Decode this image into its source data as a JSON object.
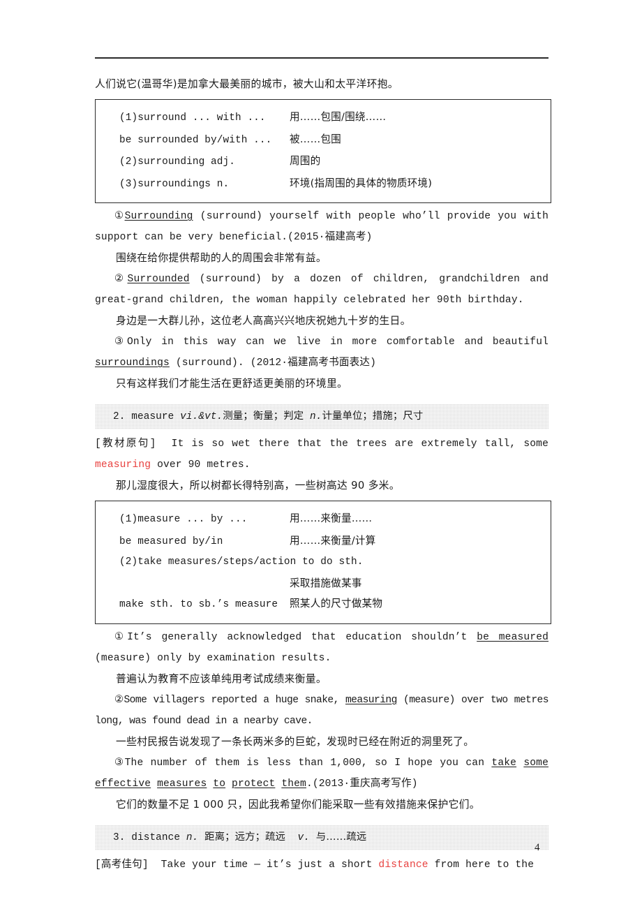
{
  "page": {
    "number": "4",
    "top_rule": true
  },
  "sections": [
    {
      "id": "surround-translation",
      "type": "chinese-paragraph",
      "text": "人们说它(温哥华)是加拿大最美丽的城市，被大山和太平洋环抱。"
    },
    {
      "id": "surround-table",
      "type": "phrase-box",
      "rows": [
        {
          "en": "(1)surround ... with ...",
          "cn": "用……包围/围绕……"
        },
        {
          "en": "be surrounded by/with ...",
          "cn": "被……包围"
        },
        {
          "en": "(2)surrounding adj.",
          "en_italic": "adj.",
          "cn": "周围的"
        },
        {
          "en": "(3)surroundings n.",
          "en_italic": "n.",
          "cn": "环境(指周围的具体的物质环境)"
        }
      ]
    },
    {
      "id": "surround-example-1",
      "type": "example",
      "marker": "①",
      "answer": "Surrounding",
      "en_before": "",
      "en_after": " (surround) yourself with people who’ll provide you with support can be very beneficial.(2015·福建高考)",
      "cn": "围绕在给你提供帮助的人的周围会非常有益。"
    },
    {
      "id": "surround-example-2",
      "type": "example",
      "marker": "②",
      "answer": "Surrounded",
      "en_after": " (surround) by a dozen of children, grandchildren and great-grand children, the woman happily celebrated her 90th birthday.",
      "cn": "身边是一大群儿孙，这位老人高高兴兴地庆祝她九十岁的生日。"
    },
    {
      "id": "surround-example-3",
      "type": "example",
      "marker": "③",
      "en_before": "Only in this way can we live in more comfortable and beautiful ",
      "answer": "surroundings",
      "en_after": " (surround). (2012·福建高考书面表达)",
      "cn": "只有这样我们才能生活在更舒适更美丽的环境里。"
    },
    {
      "id": "measure-heading",
      "type": "gray-heading",
      "number": "2.",
      "word": "measure",
      "pos": "vi.&vt.",
      "def1": "测量；衡量；判定",
      "pos2": "n.",
      "def2": "计量单位；措施；尺寸"
    },
    {
      "id": "measure-textbook",
      "type": "textbook-sentence",
      "tag": "[教材原句]",
      "en_before": "It is so wet there that the trees are extremely tall, some ",
      "highlight": "measuring",
      "en_after": " over 90 metres.",
      "cn": "那儿湿度很大，所以树都长得特别高，一些树高达 90 多米。"
    },
    {
      "id": "measure-table",
      "type": "phrase-box",
      "rows": [
        {
          "en": "(1)measure ... by ...",
          "cn": "用……来衡量……"
        },
        {
          "en": "be measured by/in",
          "cn": "用……来衡量/计算"
        },
        {
          "en": "(2)take measures/steps/action to do sth.",
          "cn": ""
        },
        {
          "en": "",
          "cn": "采取措施做某事"
        },
        {
          "en": "make sth. to sb.’s measure",
          "cn": "照某人的尺寸做某物"
        }
      ]
    },
    {
      "id": "measure-example-1",
      "type": "example",
      "marker": "①",
      "en_before": "It’s generally acknowledged that education shouldn’t ",
      "answer": "be measured",
      "en_after": " (measure) only by examination results.",
      "cn": "普遍认为教育不应该单纯用考试成绩来衡量。"
    },
    {
      "id": "measure-example-2",
      "type": "example",
      "marker": "②",
      "en_before": "Some villagers reported a huge snake, ",
      "answer": "measuring",
      "en_after": " (measure) over two metres long, was found dead in a nearby cave.",
      "cn": "一些村民报告说发现了一条长两米多的巨蛇，发现时已经在附近的洞里死了。"
    },
    {
      "id": "measure-example-3",
      "type": "example",
      "marker": "③",
      "en_before": "The number of them is less than 1,000, so I hope you can ",
      "answer_parts": [
        "take",
        "some",
        "effective",
        "measures",
        "to",
        "protect",
        "them"
      ],
      "en_after": ".(2013·重庆高考写作)",
      "cn": "它们的数量不足 1 000 只，因此我希望你们能采取一些有效措施来保护它们。"
    },
    {
      "id": "distance-heading",
      "type": "gray-heading",
      "number": "3.",
      "word": "distance",
      "pos": "n.",
      "def1": "距离；远方；疏远",
      "pos2": "v.",
      "def2": "与……疏远"
    },
    {
      "id": "distance-example",
      "type": "textbook-sentence",
      "tag": "[高考佳句]",
      "en_before": "Take your time — it’s just a short ",
      "highlight": "distance",
      "en_after": " from here to the"
    }
  ],
  "colors": {
    "highlight_red": "#e8413f",
    "band_gray": "#d6d6d6",
    "text": "#1a1a1a",
    "rule": "#2a2a2a"
  }
}
